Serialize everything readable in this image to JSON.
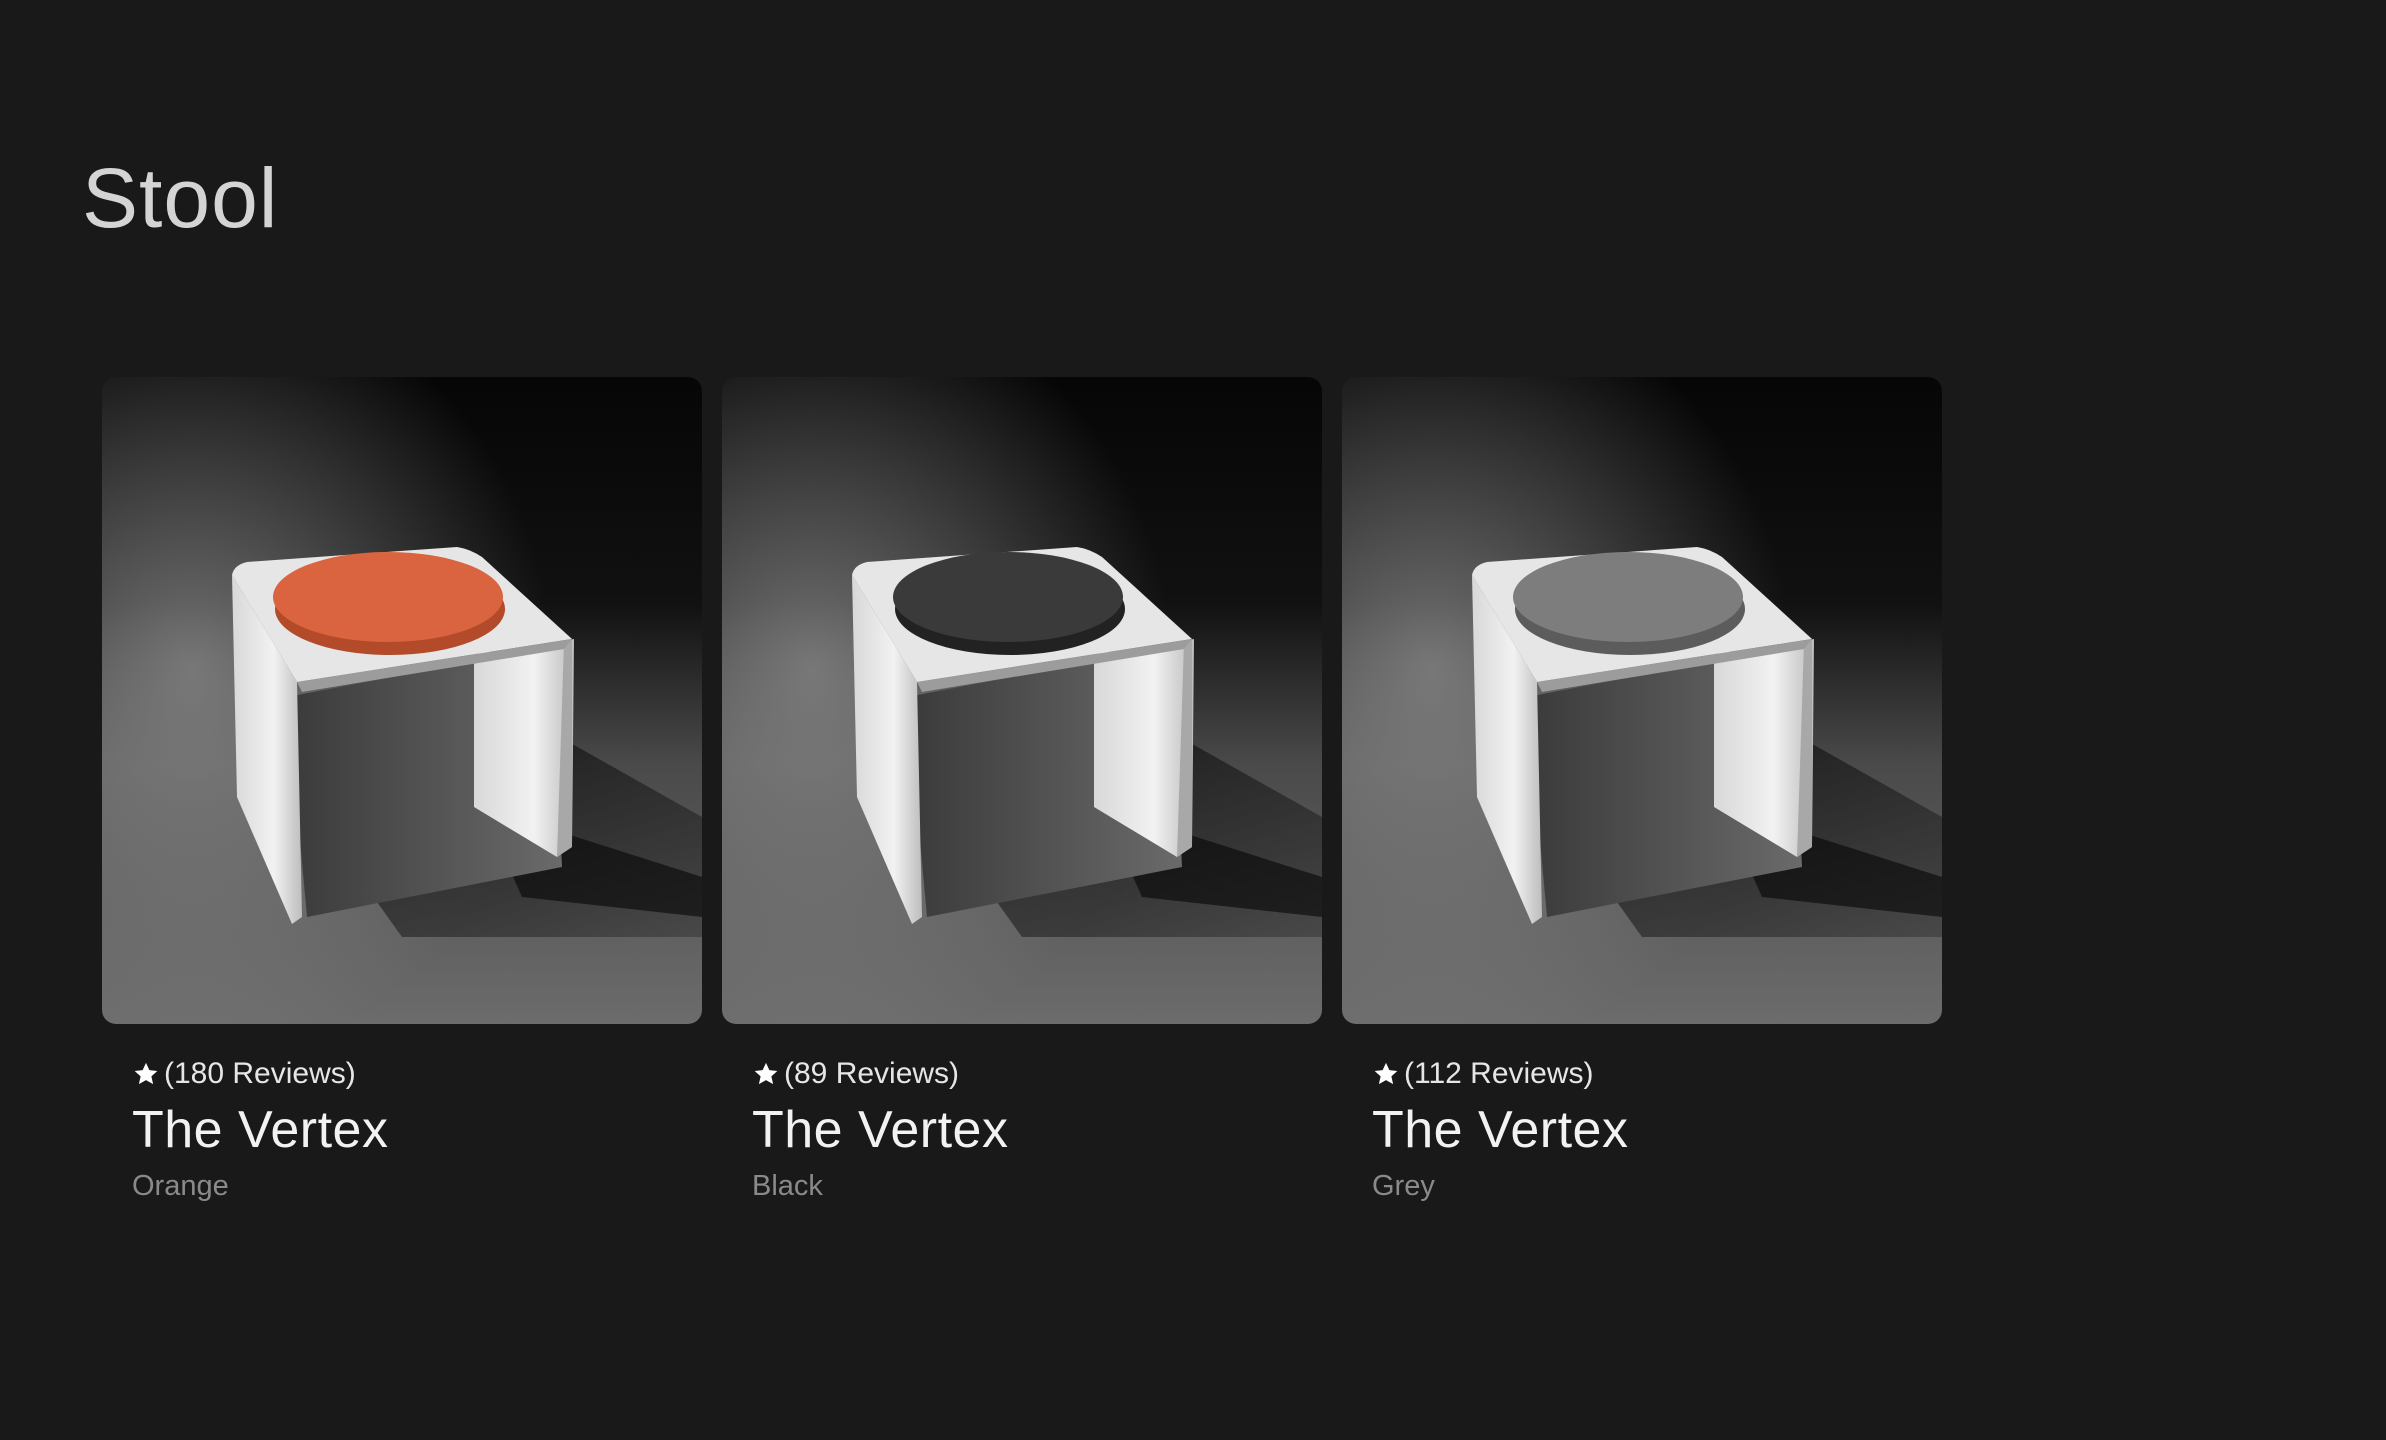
{
  "page": {
    "title": "Stool"
  },
  "products": [
    {
      "rating_text": "(180 Reviews)",
      "name": "The Vertex",
      "variant": "Orange",
      "seat_color": "#d9643f",
      "seat_rim": "#b34a2a",
      "icon": "star-icon"
    },
    {
      "rating_text": "(89 Reviews)",
      "name": "The Vertex",
      "variant": "Black",
      "seat_color": "#3a3a3a",
      "seat_rim": "#222222",
      "icon": "star-icon"
    },
    {
      "rating_text": "(112 Reviews)",
      "name": "The Vertex",
      "variant": "Grey",
      "seat_color": "#7d7d7d",
      "seat_rim": "#5c5c5c",
      "icon": "star-icon"
    }
  ]
}
